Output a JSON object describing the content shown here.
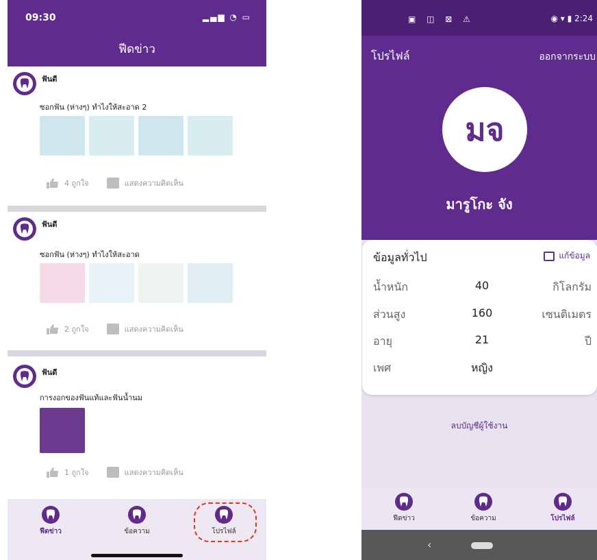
{
  "left_phone": {
    "status": {
      "time": "09:30",
      "icons": "signal wifi battery"
    },
    "appbar_title": "ฟีดข่าว",
    "posts": [
      {
        "author": "ฟันดี",
        "caption": "ซอกฟัน (ห่างๆ) ทำไงให้สะอาด 2",
        "likes": "4 ถูกใจ",
        "comment_label": "แสดงความคิดเห็น",
        "thumb_color": "#cfe6ee"
      },
      {
        "author": "ฟันดี",
        "caption": "ซอกฟัน (ห่างๆ) ทำไงให้สะอาด",
        "likes": "2 ถูกใจ",
        "comment_label": "แสดงความคิดเห็น",
        "thumb_color": "#dff0f5"
      },
      {
        "author": "ฟันดี",
        "caption": "การงอกของฟันแท้และฟันน้ำนม",
        "likes": "1 ถูกใจ",
        "comment_label": "แสดงความคิดเห็น",
        "thumb_color": "#6b3a8e"
      }
    ],
    "tabs": [
      {
        "label": "ฟีดข่าว",
        "active": true
      },
      {
        "label": "ข้อความ",
        "active": false
      },
      {
        "label": "โปรไฟล์",
        "active": false
      }
    ]
  },
  "right_phone": {
    "status": {
      "left_icons": "▣ ◫ ⊠ ⚠",
      "right_icons": "2:24"
    },
    "title": "โปรไฟล์",
    "logout": "ออกจากระบบ",
    "avatar_initials": "มจ",
    "username": "มารูโกะ จัง",
    "card": {
      "title": "ข้อมูลทั่วไป",
      "edit": "แก้ข้อมูล",
      "rows": [
        {
          "label": "น้ำหนัก",
          "value": "40",
          "unit": "กิโลกรัม"
        },
        {
          "label": "ส่วนสูง",
          "value": "160",
          "unit": "เซนติเมตร"
        },
        {
          "label": "อายุ",
          "value": "21",
          "unit": "ปี"
        },
        {
          "label": "เพศ",
          "value": "หญิง",
          "unit": ""
        }
      ]
    },
    "delete_account": "ลบบัญชีผู้ใช้งาน",
    "tabs": [
      {
        "label": "ฟีดข่าว",
        "active": false
      },
      {
        "label": "ข้อความ",
        "active": false
      },
      {
        "label": "โปรไฟล์",
        "active": true
      }
    ],
    "nav": {
      "back": "‹"
    }
  },
  "colors": {
    "brand_purple": "#5f2b8f",
    "highlight_dash": "#e8341c"
  }
}
